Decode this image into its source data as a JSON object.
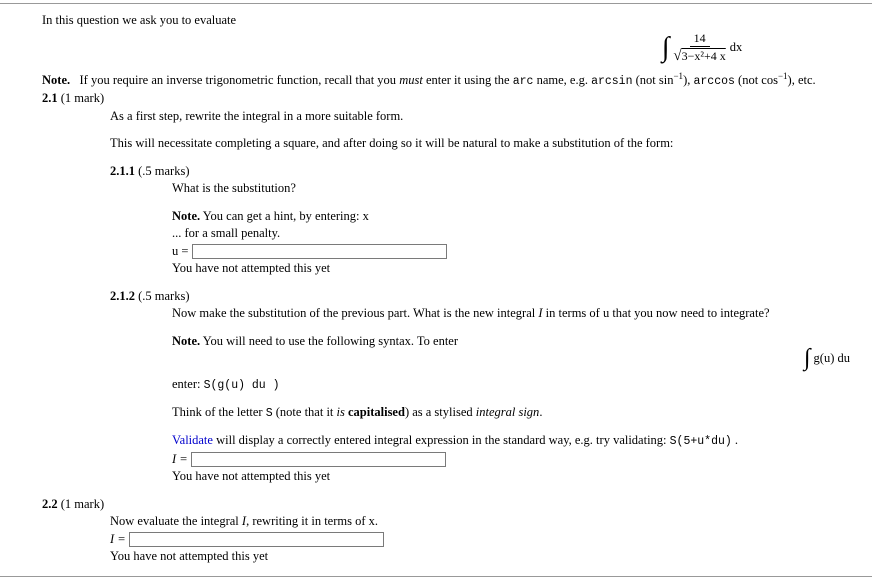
{
  "intro": "In this question we ask you to evaluate",
  "integral": {
    "numer": "14",
    "under_sqrt": "3−x²+4 x",
    "dx": "dx"
  },
  "note_label": "Note.",
  "note_line1a": "If you require an inverse trigonometric function, recall that you ",
  "note_line1b": "must",
  "note_line1c": " enter it using the ",
  "note_arc": "arc",
  "note_line1d": " name, e.g. ",
  "note_arcsin": "arcsin",
  "note_line1e": " (not sin",
  "note_sup": "−1",
  "note_line1f": "), ",
  "note_arccos": "arccos",
  "note_line1g": " (not cos",
  "note_line1h": "), etc.",
  "q21": {
    "num": "2.1 ",
    "marks": "(1 mark)",
    "line_a": "As a first step, rewrite the integral in a more suitable form.",
    "line_b": "This will necessitate completing a square, and after doing so it will be natural to make a substitution of the form:"
  },
  "q211": {
    "num": "2.1.1 ",
    "marks": "(.5 marks)",
    "line_a": "What is the substitution?",
    "note_b": "Note.",
    "note_c": " You can get a hint, by entering: x",
    "note_d": "... for a small penalty.",
    "u_eq": "u = ",
    "status": "You have not attempted this yet"
  },
  "q212": {
    "num": "2.1.2 ",
    "marks": "(.5 marks)",
    "line_a_1": "Now make the substitution of the previous part. What is the new integral ",
    "line_a_I": "I",
    "line_a_2": " in terms of u that you now need to integrate?",
    "note_b": "Note.",
    "note_c": " You will need to use the following syntax. To enter",
    "right_int": "g(u) du",
    "enter_line_pre": "enter: ",
    "enter_line_code": "S(g(u) du )",
    "think_a": "Think of the letter ",
    "think_S": "S",
    "think_b": " (note that it ",
    "think_is": "is",
    "think_c": " capitalised",
    "think_d": ") as a stylised ",
    "think_e": "integral sign",
    "think_f": ".",
    "val_a": "Validate",
    "val_b": " will display a correctly entered integral expression in the standard way, e.g. try validating: ",
    "val_c": "S(5+u*du)",
    "val_d": " .",
    "i_eq": "I = ",
    "status": "You have not attempted this yet"
  },
  "q22": {
    "num": "2.2 ",
    "marks": "(1 mark)",
    "line_a_1": "Now evaluate the integral ",
    "line_a_I": "I",
    "line_a_2": ", rewriting it in terms of x.",
    "i_eq": "I = ",
    "status": "You have not attempted this yet"
  }
}
